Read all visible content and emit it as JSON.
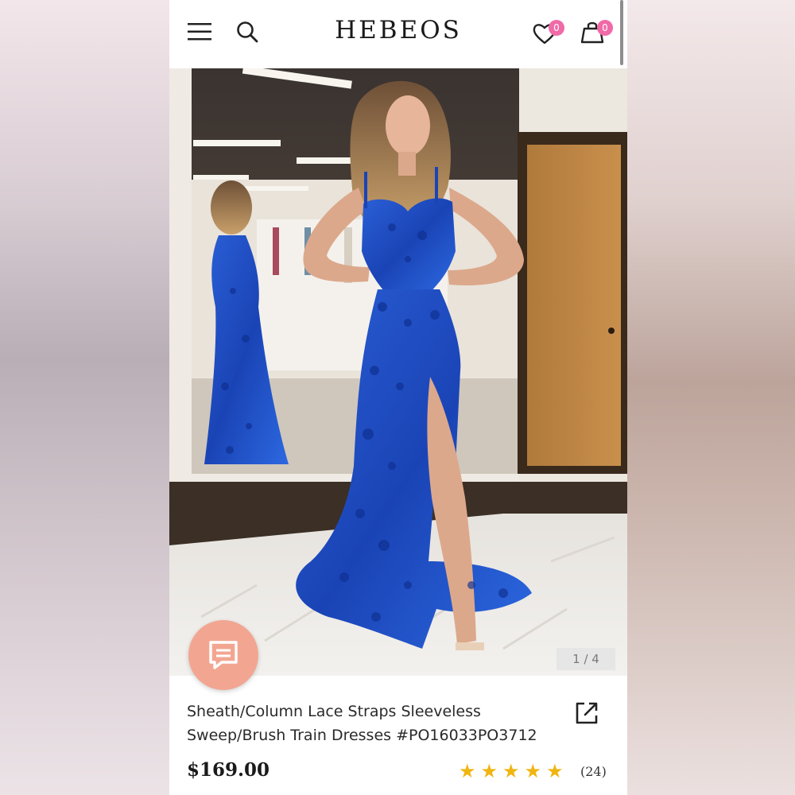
{
  "header": {
    "brand": "HEBEOS",
    "wishlist_count": "0",
    "cart_count": "0"
  },
  "gallery": {
    "counter": "1 / 4"
  },
  "product": {
    "title_line1": "Sheath/Column Lace Straps Sleeveless",
    "title_line2": "Sweep/Brush Train Dresses  #PO16033PO3712",
    "price": "$169.00",
    "rating_stars": 5,
    "reviews": "(24)"
  },
  "colors": {
    "accent": "#f06aa8",
    "chat": "#f2a692",
    "star": "#f0b511",
    "dress": "#1f4fc4"
  },
  "icons": [
    "menu-icon",
    "search-icon",
    "heart-icon",
    "bag-icon",
    "chat-icon",
    "share-icon",
    "star-icon"
  ]
}
